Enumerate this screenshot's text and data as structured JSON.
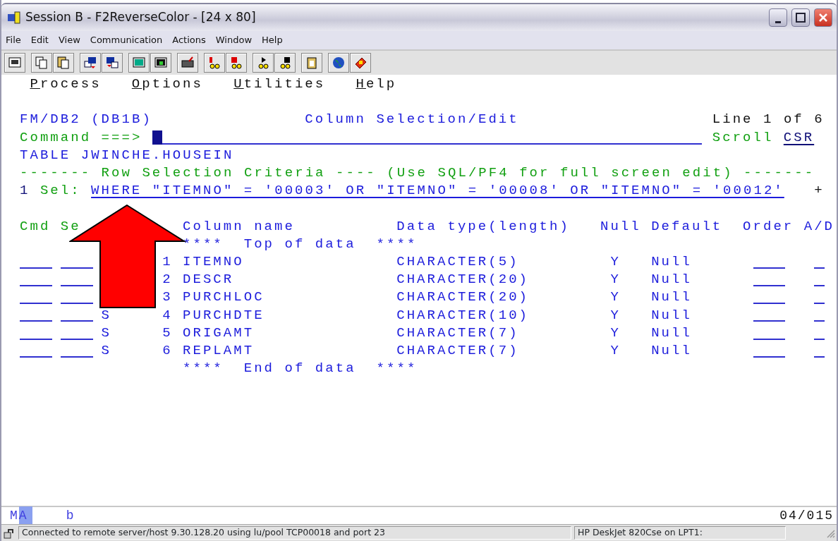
{
  "window": {
    "title": "Session B - F2ReverseColor - [24 x 80]"
  },
  "menu": [
    "File",
    "Edit",
    "View",
    "Communication",
    "Actions",
    "Window",
    "Help"
  ],
  "action_bar": [
    "Process",
    "Options",
    "Utilities",
    "Help"
  ],
  "panel": {
    "product": "FM/DB2 (DB1B)",
    "title": "Column Selection/Edit",
    "line_info": "Line 1 of 6"
  },
  "command": {
    "label": "Command ===>",
    "scroll_label": "Scroll",
    "scroll_value": "CSR"
  },
  "table_name": "TABLE JWINCHE.HOUSEIN",
  "criteria_banner": "------- Row Selection Criteria ---- (Use SQL/PF4 for full screen edit) -------",
  "selection": {
    "number": "1",
    "label": "Sel:",
    "value": "WHERE \"ITEMNO\" = '00003' OR \"ITEMNO\" = '00008' OR \"ITEMNO\" = '00012'",
    "more": "+"
  },
  "columns": [
    "Cmd",
    "Se",
    "Column name",
    "Data type(length)",
    "Null",
    "Default",
    "Order",
    "A/D"
  ],
  "top_marker": "****  Top of data  ****",
  "rows": [
    {
      "sel": "",
      "number": "1",
      "name": "ITEMNO",
      "type": "CHARACTER(5)",
      "nulls": "Y",
      "default": "Null"
    },
    {
      "sel": "",
      "number": "2",
      "name": "DESCR",
      "type": "CHARACTER(20)",
      "nulls": "Y",
      "default": "Null"
    },
    {
      "sel": "",
      "number": "3",
      "name": "PURCHLOC",
      "type": "CHARACTER(20)",
      "nulls": "Y",
      "default": "Null"
    },
    {
      "sel": "S",
      "number": "4",
      "name": "PURCHDTE",
      "type": "CHARACTER(10)",
      "nulls": "Y",
      "default": "Null"
    },
    {
      "sel": "S",
      "number": "5",
      "name": "ORIGAMT",
      "type": "CHARACTER(7)",
      "nulls": "Y",
      "default": "Null"
    },
    {
      "sel": "S",
      "number": "6",
      "name": "REPLAMT",
      "type": "CHARACTER(7)",
      "nulls": "Y",
      "default": "Null"
    }
  ],
  "end_marker": "****  End of data  ****",
  "oia": {
    "mode": "MA",
    "indicator": "b",
    "cursor_position": "04/015"
  },
  "status_bar": {
    "message": "Connected to remote server/host 9.30.128.20 using lu/pool TCP00018 and port 23",
    "printer": "HP DeskJet 820Cse on LPT1:"
  }
}
